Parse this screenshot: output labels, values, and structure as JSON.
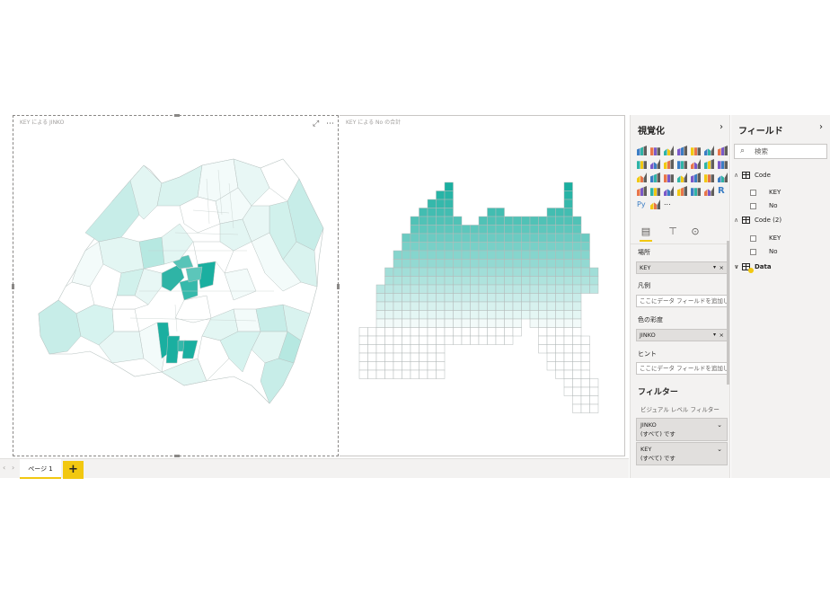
{
  "canvas": {
    "left_visual_title": "KEY による JINKO",
    "right_visual_title": "KEY による No の合計",
    "focus_icon": "focus-mode-icon",
    "more_icon": "more-options-icon"
  },
  "page_tabs": {
    "tabs": [
      {
        "label": "ページ 1"
      }
    ],
    "add_label": "+",
    "prev_icon": "‹",
    "next_icon": "›"
  },
  "visualizations": {
    "title": "視覚化",
    "collapse_icon": "›",
    "icons": [
      "stacked-bar",
      "clustered-bar",
      "stacked-bar-100",
      "stacked-column",
      "clustered-column",
      "stacked-column-100",
      "line",
      "area",
      "stacked-area",
      "line-column",
      "line-clustered-column",
      "ribbon",
      "waterfall",
      "scatter",
      "pie",
      "donut",
      "treemap",
      "map",
      "filled-map",
      "funnel",
      "gauge",
      "card",
      "multi-row-card",
      "kpi",
      "slicer",
      "table",
      "matrix",
      "r-visual",
      "python-visual",
      "key-influencers",
      "more"
    ],
    "more_label": "...",
    "wells": {
      "location_label": "場所",
      "location_value": "KEY",
      "legend_label": "凡例",
      "legend_placeholder": "ここにデータ フィールドを追加して...",
      "saturation_label": "色の彩度",
      "saturation_value": "JINKO",
      "tooltip_label": "ヒント",
      "tooltip_placeholder": "ここにデータ フィールドを追加して..."
    },
    "filters": {
      "title": "フィルター",
      "visual_level": "ビジュアル レベル フィルター",
      "cards": [
        {
          "field": "JINKO",
          "state": "(すべて) です"
        },
        {
          "field": "KEY",
          "state": "(すべて) です"
        }
      ]
    }
  },
  "fields": {
    "title": "フィールド",
    "collapse_icon": "›",
    "search_placeholder": "検索",
    "tables": [
      {
        "name": "Code",
        "fields": [
          "KEY",
          "No"
        ],
        "expanded": true
      },
      {
        "name": "Code (2)",
        "fields": [
          "KEY",
          "No"
        ],
        "expanded": true
      },
      {
        "name": "Data",
        "fields": [],
        "expanded": false
      }
    ]
  },
  "colors": {
    "accent": "#f2c811",
    "map_teal_dark": "#1aafa0",
    "map_teal_light": "#d6f3f0"
  }
}
